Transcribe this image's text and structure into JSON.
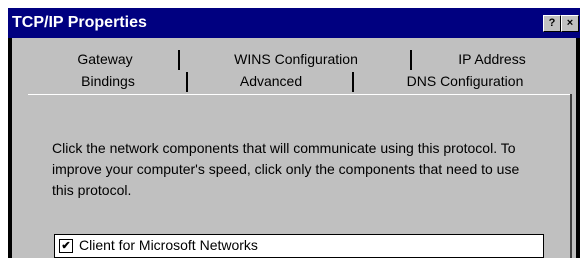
{
  "window": {
    "title": "TCP/IP Properties",
    "help_glyph": "?",
    "close_glyph": "×"
  },
  "tabs_back": [
    "Gateway",
    "WINS Configuration",
    "IP Address"
  ],
  "tabs_front": [
    "Bindings",
    "Advanced",
    "DNS Configuration"
  ],
  "active_tab": "Bindings",
  "description": "Click the network components that will communicate using this protocol. To improve your computer's speed, click only the components that need to use this protocol.",
  "components": [
    {
      "label": "Client for Microsoft Networks",
      "checked": true,
      "check_glyph": "✔"
    }
  ],
  "colors": {
    "titlebar": "#000080",
    "face": "#c0c0c0",
    "frame": "#000000"
  }
}
